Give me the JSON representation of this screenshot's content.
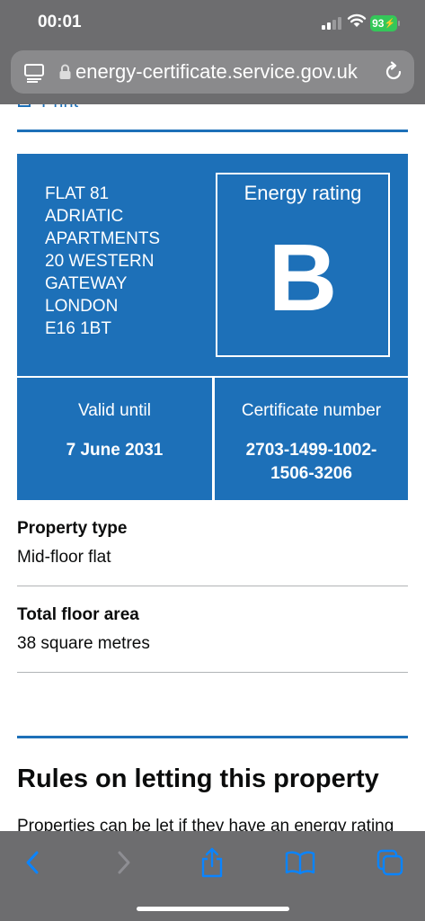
{
  "status_bar": {
    "time": "00:01",
    "battery": "93"
  },
  "browser": {
    "url": "energy-certificate.service.gov.uk"
  },
  "page": {
    "print_link": "Print",
    "certificate": {
      "address_lines": [
        "FLAT 81",
        "ADRIATIC",
        "APARTMENTS",
        "20 WESTERN",
        "GATEWAY",
        "LONDON",
        "E16 1BT"
      ],
      "rating_label": "Energy rating",
      "rating": "B",
      "valid_until_label": "Valid until",
      "valid_until": "7 June 2031",
      "certificate_number_label": "Certificate number",
      "certificate_number": "2703-1499-1002-1506-3206"
    },
    "summary": [
      {
        "label": "Property type",
        "value": "Mid-floor flat"
      },
      {
        "label": "Total floor area",
        "value": "38 square metres"
      }
    ],
    "section_heading": "Rules on letting this property",
    "section_text": "Properties can be let if they have an energy rating"
  },
  "colors": {
    "govuk_blue": "#1d70b8",
    "chrome_grey": "#6d6d6f",
    "ios_accent": "#0a84ff",
    "battery_green": "#34c759"
  },
  "toolbar": {
    "icons": [
      "back-icon",
      "forward-icon",
      "share-icon",
      "bookmarks-icon",
      "tabs-icon"
    ]
  }
}
